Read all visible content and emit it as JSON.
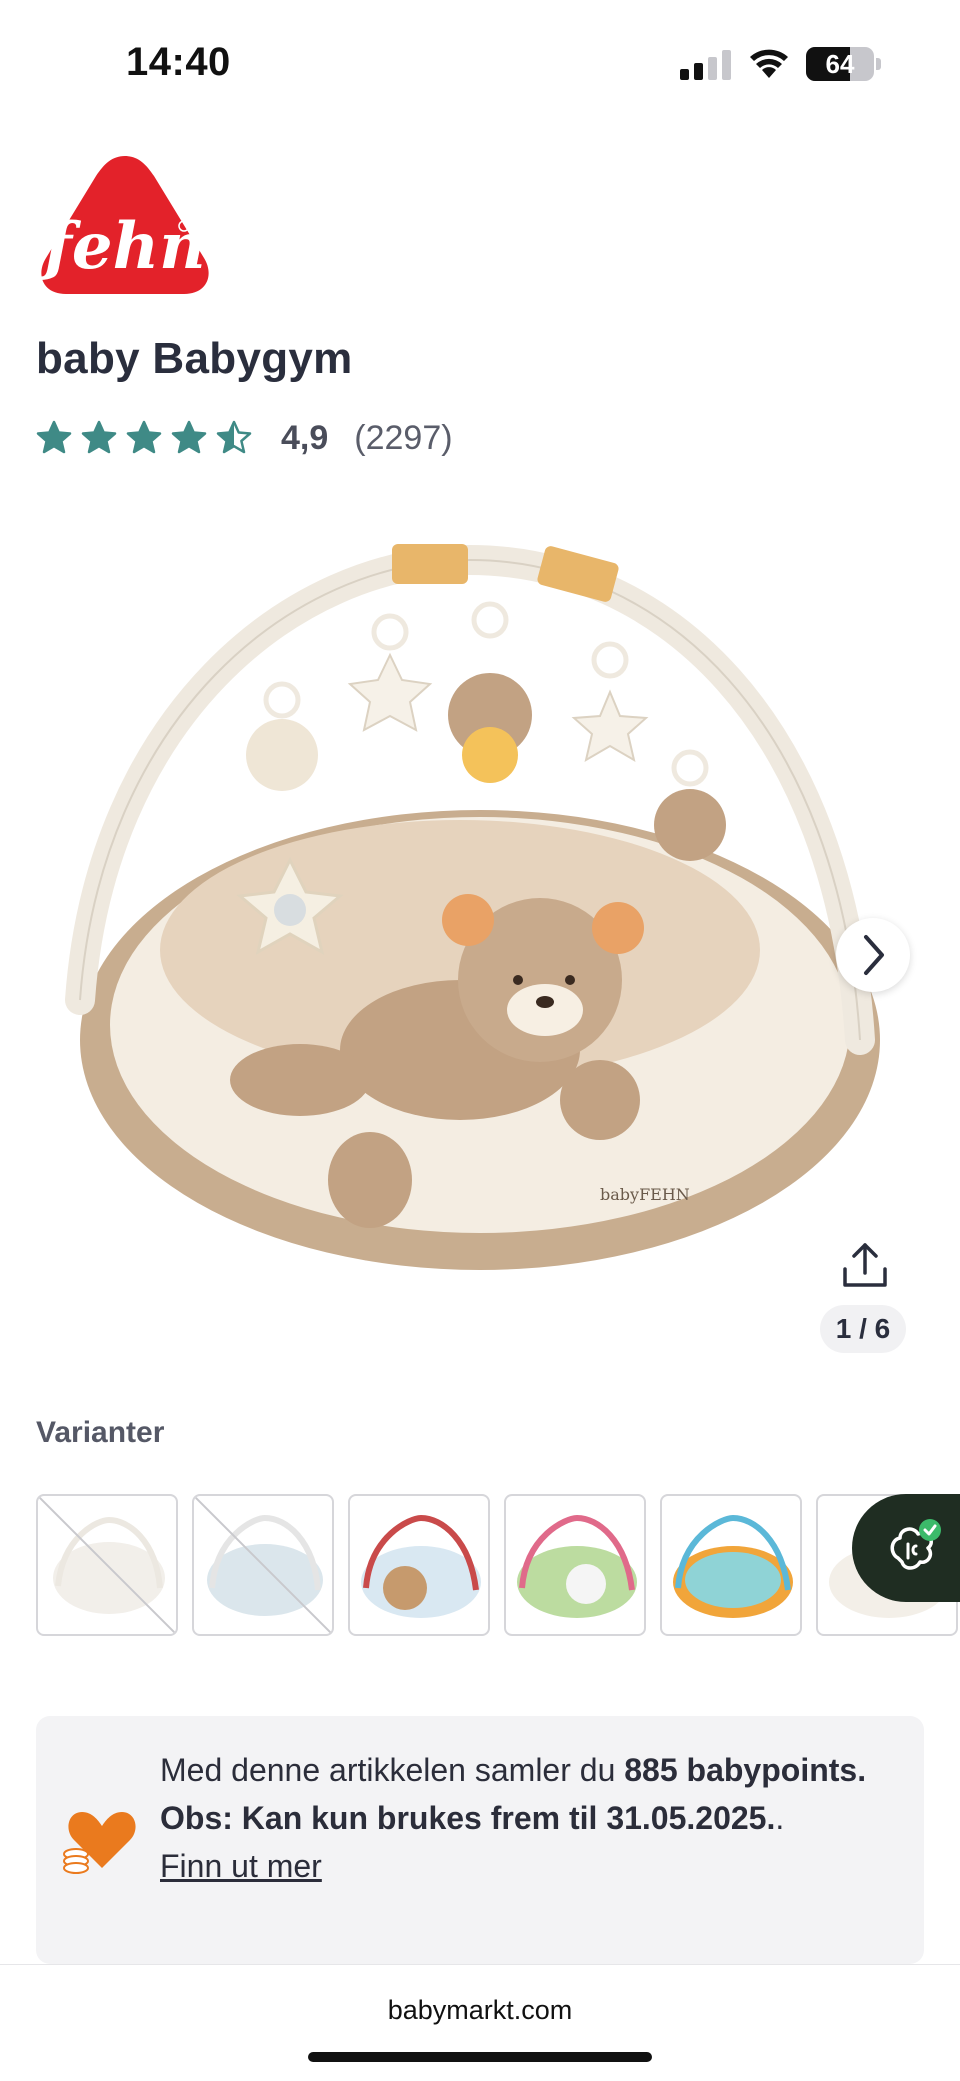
{
  "status_bar": {
    "time": "14:40",
    "battery_level": "64",
    "battery_fraction": 0.64,
    "icons": [
      "signal-icon",
      "wifi-icon",
      "battery-icon"
    ]
  },
  "brand": {
    "logo_text": "fehn",
    "logo_color": "#e3222a"
  },
  "product": {
    "title": "baby Babygym",
    "rating_value": "4,9",
    "rating_stars": 4.9,
    "rating_count": "(2297)",
    "star_color": "#3f8a86"
  },
  "gallery": {
    "pager": "1 / 6",
    "next_icon": "chevron-right-icon",
    "share_icon": "share-icon",
    "image_label": "babyFEHN"
  },
  "variants": {
    "label": "Varianter",
    "items": [
      {
        "name": "variant-1",
        "available": false
      },
      {
        "name": "variant-2",
        "available": false
      },
      {
        "name": "variant-3",
        "available": true
      },
      {
        "name": "variant-4",
        "available": true
      },
      {
        "name": "variant-5",
        "available": true
      },
      {
        "name": "variant-6",
        "available": true
      }
    ]
  },
  "chat": {
    "icon": "chat-assistant-icon",
    "accent": "#3cba6a"
  },
  "points": {
    "text_before": "Med denne artikkelen samler du ",
    "points_bold": "885 babypoints. Obs: Kan kun brukes frem til 31.05.2025.",
    "text_after": ".",
    "link": "Finn ut mer",
    "icon_color": "#ea7a1e"
  },
  "browser": {
    "url": "babymarkt.com"
  }
}
